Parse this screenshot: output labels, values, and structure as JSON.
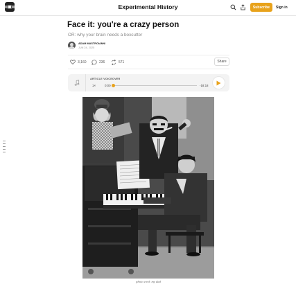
{
  "header": {
    "site_title": "Experimental History",
    "subscribe_label": "Subscribe",
    "signin_label": "Sign in",
    "icons": [
      "publication-logo",
      "search-icon",
      "share-out-icon",
      "notification-bell-icon"
    ]
  },
  "post": {
    "title": "Face it: you're a crazy person",
    "subtitle": "OR: why your brain needs a boxcutter",
    "author": "ADAM MASTROIANNI",
    "date": "JUN 24, 2025"
  },
  "engagement": {
    "likes": "3,160",
    "comments": "236",
    "restacks": "571",
    "share_label": "Share"
  },
  "voiceover": {
    "label": "ARTICLE VOICEOVER",
    "speed": "1×",
    "current_time": "0:00",
    "remaining_time": "-18:18",
    "progress": 0,
    "accent": "#e8a21b"
  },
  "image": {
    "subject": "black-and-white photograph of a man playing a piano with two people posing behind him",
    "caption": "photo cred: my dad"
  },
  "colors": {
    "accent": "#e8a21b",
    "text": "#1a1a1a",
    "muted": "#8a8a8a"
  }
}
